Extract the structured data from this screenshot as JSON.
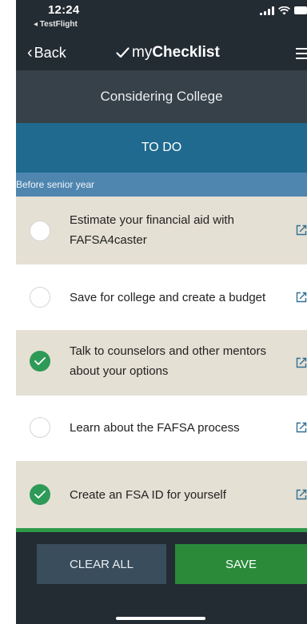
{
  "status_bar": {
    "time": "12:24",
    "return_app": "◂ TestFlight"
  },
  "nav": {
    "back_label": "Back",
    "brand_prefix": "my",
    "brand_bold": "Checklist"
  },
  "section_title": "Considering College",
  "tab_label": "TO DO",
  "group_header": "Before senior year",
  "tasks": [
    {
      "label": "Estimate your financial aid with FAFSA4caster",
      "checked": false
    },
    {
      "label": "Save for college and create a budget",
      "checked": false
    },
    {
      "label": "Talk to counselors and other mentors about your options",
      "checked": true
    },
    {
      "label": "Learn about the FAFSA process",
      "checked": false
    },
    {
      "label": "Create an FSA ID for yourself",
      "checked": true
    }
  ],
  "buttons": {
    "clear_all": "CLEAR ALL",
    "save": "SAVE"
  },
  "colors": {
    "dark": "#232b33",
    "section": "#374149",
    "tab": "#1f6a8e",
    "group": "#4f86b0",
    "shaded_row": "#e5e0d4",
    "check_green": "#2e9a58",
    "save_green": "#2a8a3a"
  },
  "icons": {
    "back": "chevron-left-icon",
    "brand": "checkmark-icon",
    "menu": "hamburger-menu-icon",
    "task_link": "external-link-icon"
  }
}
